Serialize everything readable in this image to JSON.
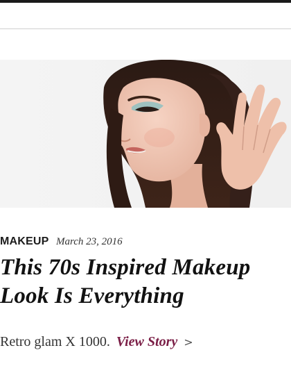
{
  "article": {
    "category": "MAKEUP",
    "date": "March 23, 2016",
    "headline": "This 70s Inspired Makeup Look Is Everything",
    "teaser": "Retro glam X 1000.",
    "cta_label": "View Story",
    "cta_chevron": ">"
  },
  "colors": {
    "top_bar": "#1a1a1a",
    "cta": "#7a1d45",
    "divider": "#cfcfcf"
  },
  "icons": {
    "cta_chevron": "chevron-right-icon"
  }
}
